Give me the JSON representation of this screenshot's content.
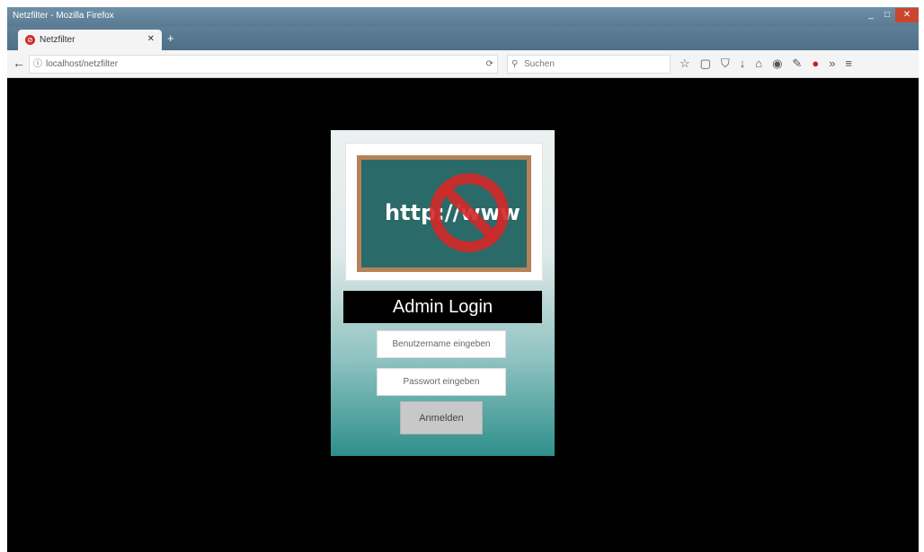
{
  "window": {
    "title": "Netzfilter - Mozilla Firefox"
  },
  "tab": {
    "title": "Netzfilter"
  },
  "navbar": {
    "url": "localhost/netzfilter",
    "search_placeholder": "Suchen"
  },
  "login": {
    "logo_text": "http://www",
    "title": "Admin Login",
    "username_placeholder": "Benutzername eingeben",
    "password_placeholder": "Passwort eingeben",
    "submit_label": "Anmelden"
  },
  "colors": {
    "page_background": "#000000",
    "card_gradient_top": "#ecf1f1",
    "card_gradient_bottom": "#2f8f8c",
    "title_bar": "#000000",
    "board": "#2a6a68",
    "board_frame": "#b5825a",
    "block_sign": "#d42828"
  },
  "icons": [
    "back-icon",
    "site-info-icon",
    "reload-icon",
    "search-icon",
    "bookmark-star-icon",
    "library-icon",
    "pocket-icon",
    "download-icon",
    "home-icon",
    "sync-icon",
    "extension-icon",
    "adblock-icon",
    "menu-icon"
  ]
}
